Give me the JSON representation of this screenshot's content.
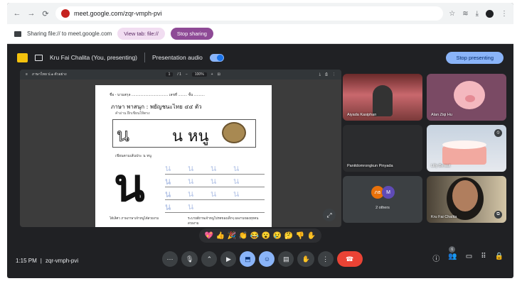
{
  "browser": {
    "url": "meet.google.com/zqr-vmph-pvi",
    "back": "←",
    "forward": "→",
    "reload": "⟳"
  },
  "sharebar": {
    "text": "Sharing file:// to meet.google.com",
    "view_tab": "View tab: file://",
    "stop_sharing": "Stop sharing"
  },
  "meettop": {
    "presenter": "Kru Fai Chalita (You, presenting)",
    "audio": "Presentation audio",
    "stop_presenting": "Stop presenting"
  },
  "pdf": {
    "file": "ภาษาไทย ป.๑ ตัวอย่าง",
    "page": "1",
    "pages": "/ 1",
    "zoom": "100%",
    "name_line": "ชื่อ - นามสกุล ..................................... เลขที่ ......... ชั้น ...........",
    "title": "ภาษา พาสนุก : พยัญชนะไทย ๔๔ ตัว",
    "subtitle": "คำอ่าน ฝึกเขียนให้ตรง",
    "big_letter": "น หนู",
    "instruction": "เขียนตามเส้นประ น หนู",
    "huge_letter": "น",
    "trace_rows": [
      "น น น น น",
      "น น น น น",
      "น น น น น",
      "น น"
    ],
    "footer_left": "ได้เลิศว ภาพภาษาเจ้าหนูได้สวยงาม",
    "footer_right": "ระบายสีภาพเจ้าหนูโปรดของเด็กๆ ผลงานของทุกคนสวยงาม"
  },
  "tiles": [
    {
      "name": "Aiyada Kasiphan"
    },
    {
      "name": "Alan Ziqi Hu"
    },
    {
      "name": "Panitdomrongkun Pinyada"
    },
    {
      "name": "Lilly Beraut"
    },
    {
      "name": "2 others",
      "avatars": [
        "ภธ",
        "M"
      ]
    },
    {
      "name": "Kru Fai Chalita"
    }
  ],
  "reactions": [
    "💖",
    "👍",
    "🎉",
    "👏",
    "😂",
    "😮",
    "😢",
    "🤔",
    "👎",
    "✋"
  ],
  "bottom": {
    "time": "1:15 PM",
    "separator": "|",
    "code": "zqr-vmph-pvi",
    "participants_badge": "6"
  },
  "colors": {
    "accent": "#8ab4f8",
    "end_call": "#ea4335",
    "stop_sharing": "#8e4a96"
  }
}
